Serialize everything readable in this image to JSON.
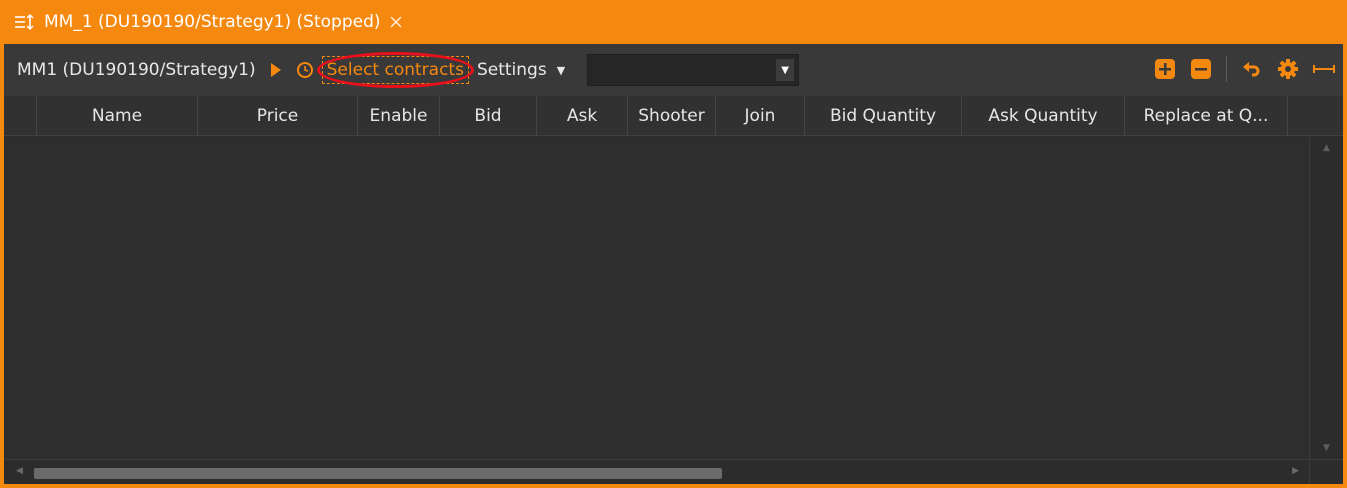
{
  "window": {
    "title": "MM_1 (DU190190/Strategy1) (Stopped)",
    "accent_color": "#f5880f"
  },
  "toolbar": {
    "strategy_label": "MM1 (DU190190/Strategy1)",
    "play_icon": "play-icon",
    "clock_icon": "clock-icon",
    "select_contracts_label": "Select contracts",
    "settings_label": "Settings",
    "combo_value": "",
    "right_icons": [
      "add-icon",
      "remove-icon",
      "undo-icon",
      "gear-icon",
      "expand-icon"
    ]
  },
  "grid": {
    "columns": [
      {
        "label": ""
      },
      {
        "label": "Name"
      },
      {
        "label": "Price"
      },
      {
        "label": "Enable"
      },
      {
        "label": "Bid"
      },
      {
        "label": "Ask"
      },
      {
        "label": "Shooter"
      },
      {
        "label": "Join"
      },
      {
        "label": "Bid Quantity"
      },
      {
        "label": "Ask Quantity"
      },
      {
        "label": "Replace at Q..."
      }
    ],
    "rows": []
  }
}
